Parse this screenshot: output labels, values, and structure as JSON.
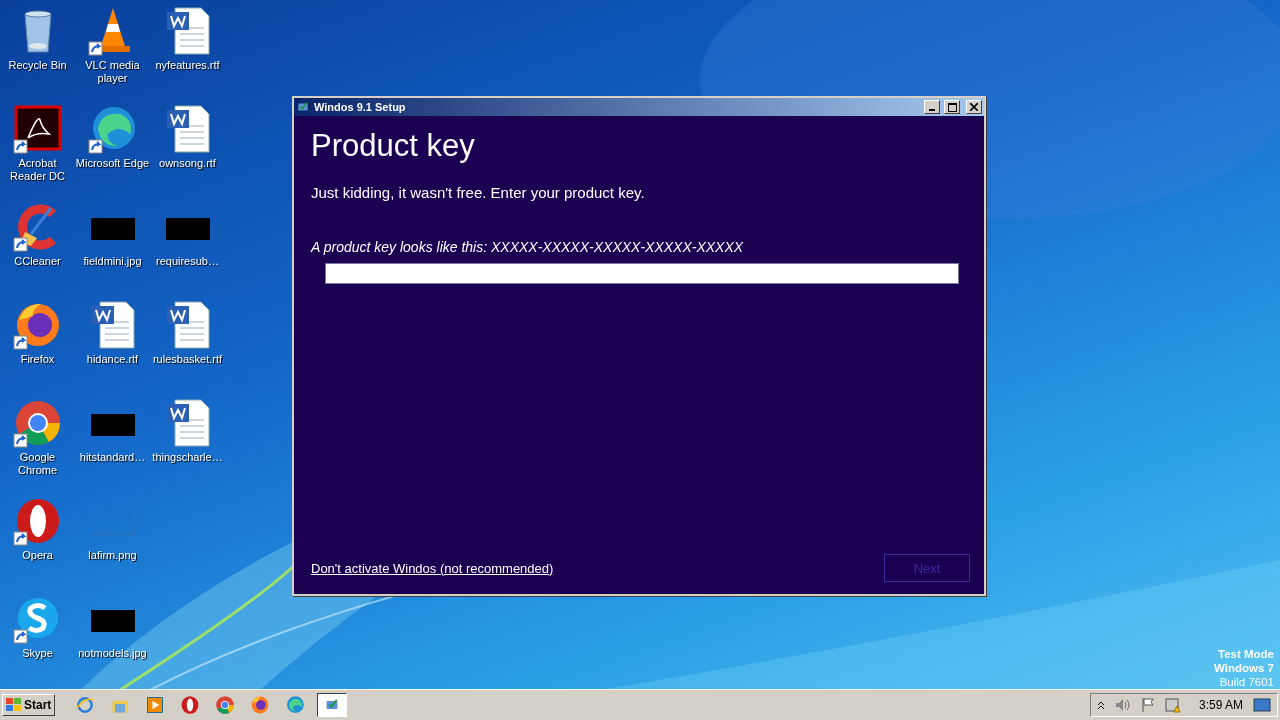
{
  "desktop_icons": [
    {
      "label": "Recycle Bin",
      "kind": "recycle",
      "shortcut": false
    },
    {
      "label": "Acrobat Reader DC",
      "kind": "acrobat",
      "shortcut": true
    },
    {
      "label": "CCleaner",
      "kind": "ccleaner",
      "shortcut": true
    },
    {
      "label": "Firefox",
      "kind": "firefox",
      "shortcut": true
    },
    {
      "label": "Google Chrome",
      "kind": "chrome",
      "shortcut": true
    },
    {
      "label": "Opera",
      "kind": "opera",
      "shortcut": true
    },
    {
      "label": "Skype",
      "kind": "skype",
      "shortcut": true
    },
    {
      "label": "VLC media player",
      "kind": "vlc",
      "shortcut": true
    },
    {
      "label": "Microsoft Edge",
      "kind": "edge",
      "shortcut": true
    },
    {
      "label": "fieldmini.jpg",
      "shortcut": false
    },
    {
      "label": "hidance.rtf",
      "kind": "word",
      "shortcut": false
    },
    {
      "label": "hitstandard…",
      "shortcut": false
    },
    {
      "label": "lafirm.png",
      "kind": "blank",
      "shortcut": false
    },
    {
      "label": "notmodels.jpg",
      "shortcut": false
    },
    {
      "label": "nyfeatures.rtf",
      "kind": "word",
      "shortcut": false
    },
    {
      "label": "ownsong.rtf",
      "kind": "word",
      "shortcut": false
    },
    {
      "label": "requiresub…",
      "shortcut": false
    },
    {
      "label": "rulesbasket.rtf",
      "kind": "word",
      "shortcut": false
    },
    {
      "label": "thingscharle…",
      "kind": "word",
      "shortcut": false
    }
  ],
  "window": {
    "title": "Windos 9.1 Setup",
    "heading": "Product key",
    "subtitle": "Just kidding, it wasn't free. Enter your product key.",
    "hint": "A product key looks like this: XXXXX-XXXXX-XXXXX-XXXXX-XXXXX",
    "skip_link": "Don't activate Windos (not recommended)",
    "next_button": {
      "label": "Next",
      "disabled": true
    }
  },
  "os_notice": [
    "Test Mode",
    "Windows 7",
    "Build 7601"
  ],
  "taskbar": {
    "start": "Start",
    "quick_launch": [
      {
        "kind": "ie"
      },
      {
        "kind": "explorer"
      },
      {
        "kind": "media"
      },
      {
        "kind": "opera"
      },
      {
        "kind": "chrome"
      },
      {
        "kind": "firefox"
      },
      {
        "kind": "edge"
      }
    ],
    "tasks": [
      {
        "kind": "setup",
        "selected": true
      }
    ],
    "clock": "3:59 AM"
  }
}
